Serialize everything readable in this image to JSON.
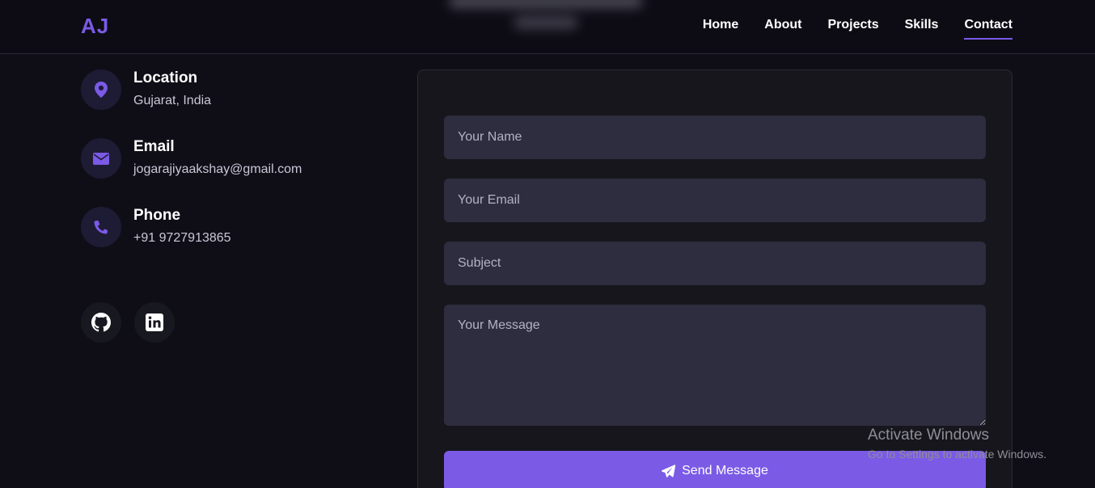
{
  "header": {
    "logo": "AJ",
    "nav": [
      {
        "label": "Home"
      },
      {
        "label": "About"
      },
      {
        "label": "Projects"
      },
      {
        "label": "Skills"
      },
      {
        "label": "Contact",
        "active": true
      }
    ]
  },
  "contact_info": [
    {
      "title": "Location",
      "value": "Gujarat, India",
      "icon": "map-pin-icon"
    },
    {
      "title": "Email",
      "value": "jogarajiyaakshay@gmail.com",
      "icon": "envelope-icon"
    },
    {
      "title": "Phone",
      "value": "+91 9727913865",
      "icon": "phone-icon"
    }
  ],
  "social": [
    {
      "icon": "github-icon"
    },
    {
      "icon": "linkedin-icon"
    }
  ],
  "form": {
    "name_placeholder": "Your Name",
    "email_placeholder": "Your Email",
    "subject_placeholder": "Subject",
    "message_placeholder": "Your Message",
    "submit_label": "Send Message",
    "submit_icon": "paper-plane-icon"
  },
  "watermark": {
    "title": "Activate Windows",
    "subtitle": "Go to Settings to activate Windows."
  },
  "colors": {
    "accent": "#7b5ae6",
    "background": "#0f0e17",
    "field": "#2d2d3f",
    "icon_circle": "#1e1b35"
  }
}
